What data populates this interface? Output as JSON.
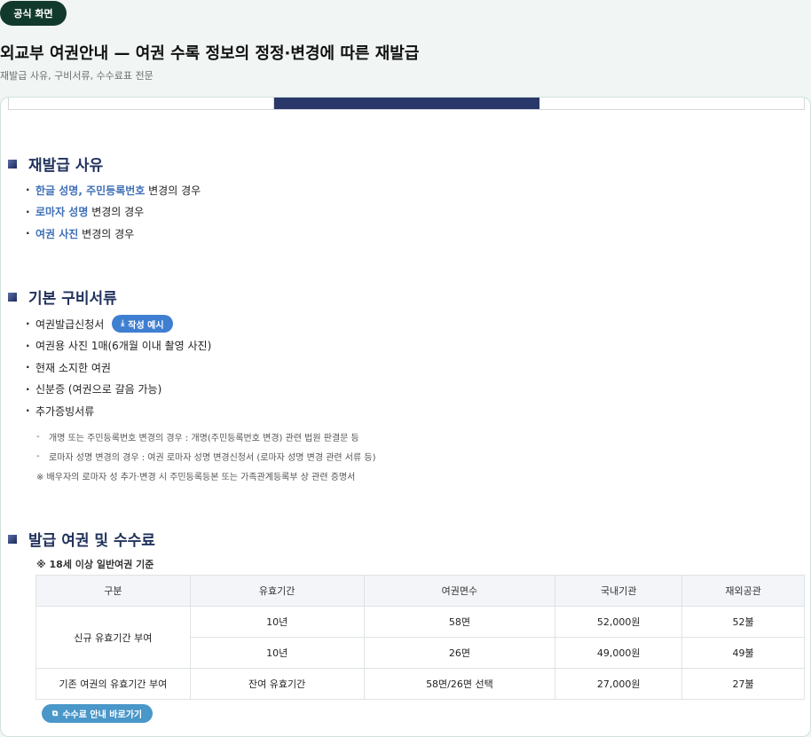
{
  "badge": "공식 화면",
  "page_title": "외교부 여권안내 — 여권 수록 정보의 정정·변경에 따른 재발급",
  "page_subtitle": "재발급 사유, 구비서류, 수수료표 전문",
  "sections": {
    "reasons": {
      "title": "재발급 사유",
      "items": [
        {
          "highlight": "한글 성명, 주민등록번호",
          "rest": " 변경의 경우"
        },
        {
          "highlight": "로마자 성명",
          "rest": " 변경의 경우"
        },
        {
          "highlight": "여권 사진",
          "rest": " 변경의 경우"
        }
      ]
    },
    "documents": {
      "title": "기본 구비서류",
      "items": [
        "여권발급신청서",
        "여권용 사진 1매(6개월 이내 촬영 사진)",
        "현재 소지한 여권",
        "신분증 (여권으로 갈음 가능)",
        "추가증빙서류"
      ],
      "example_button": "작성 예시",
      "example_icon": "download-icon",
      "notes": [
        "개명 또는 주민등록번호 변경의 경우 : 개명(주민등록번호 변경) 관련 법원 판결문 등",
        "로마자 성명 변경의 경우 : 여권 로마자 성명 변경신청서 (로마자 성명 변경 관련 서류 등)"
      ],
      "footnote": "※ 배우자의 로마자 성 추가·변경 시 주민등록등본 또는 가족관계등록부 상 관련 증명서"
    },
    "fees": {
      "title": "발급 여권 및 수수료",
      "note": "※ 18세 이상 일반여권 기준",
      "headers": [
        "구분",
        "유효기간",
        "여권면수",
        "국내기관",
        "재외공관"
      ],
      "rows": [
        {
          "category": "신규 유효기간 부여",
          "validity": "10년",
          "pages": "58면",
          "domestic": "52,000원",
          "overseas": "52불"
        },
        {
          "category": "",
          "validity": "10년",
          "pages": "26면",
          "domestic": "49,000원",
          "overseas": "49불"
        },
        {
          "category": "기존 여권의 유효기간 부여",
          "validity": "잔여 유효기간",
          "pages": "58면/26면 선택",
          "domestic": "27,000원",
          "overseas": "27불"
        }
      ],
      "link_button": "수수료 안내 바로가기",
      "link_icon": "external-link-icon"
    }
  },
  "colors": {
    "badge_bg": "#123a2c",
    "section_title": "#21325c",
    "highlight": "#3f6fb6",
    "active_tab": "#2a3769",
    "button_blue": "#3f7fd2",
    "link_button": "#4a97c9"
  }
}
